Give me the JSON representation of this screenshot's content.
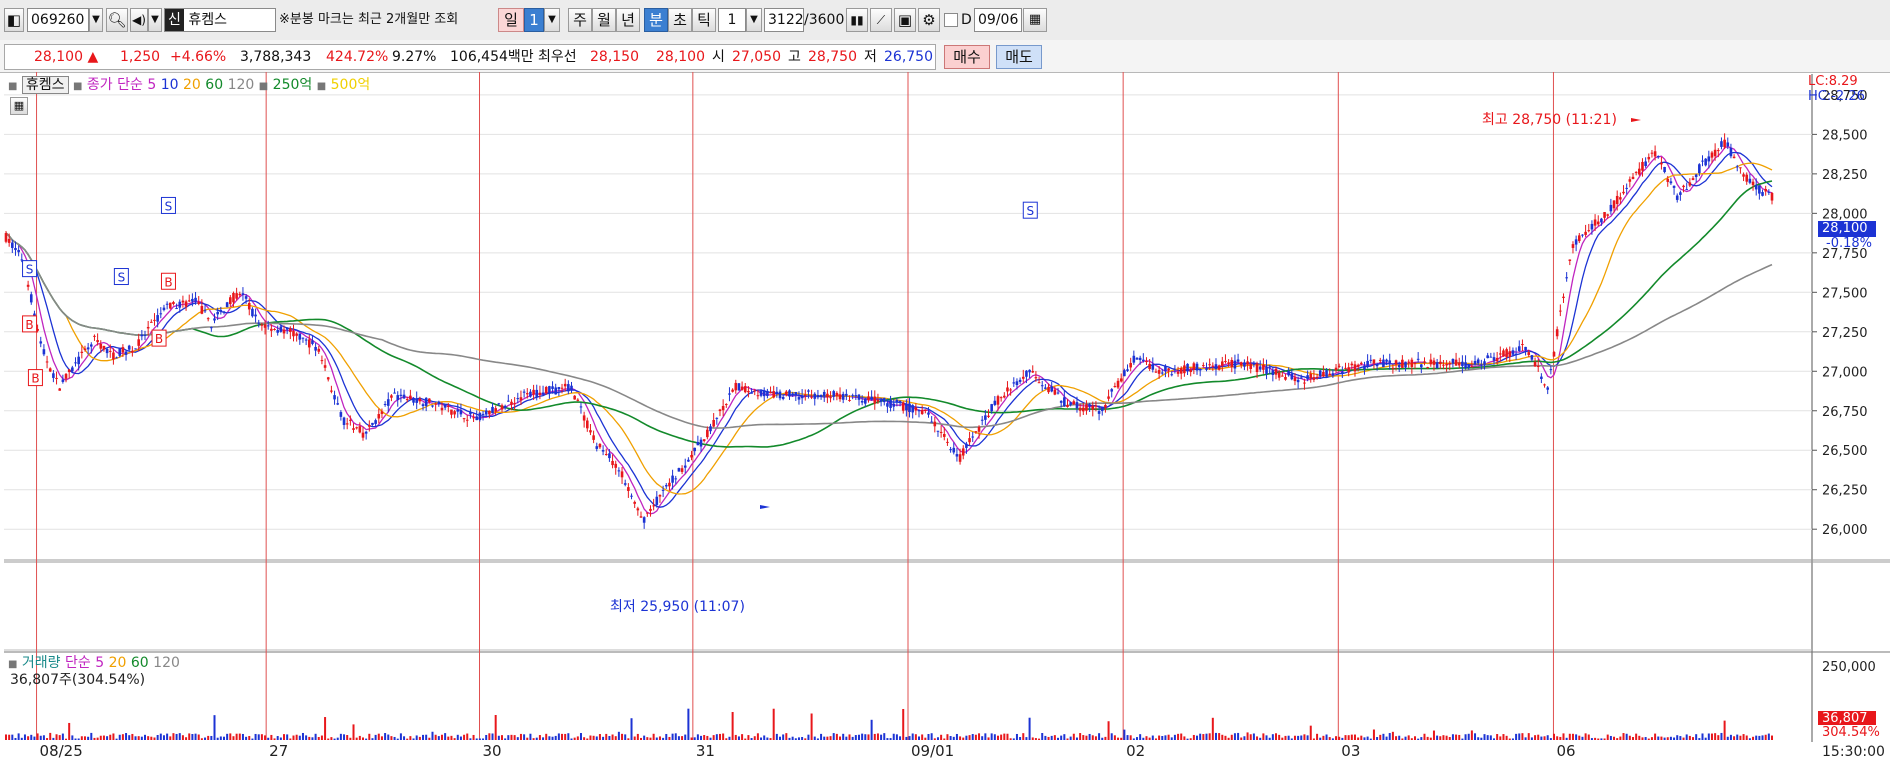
{
  "toolbar": {
    "code": "069260",
    "company_badge": "신",
    "company": "휴켐스",
    "notice": "※분봉 마크는 최근 2개월만 조회",
    "period_day": "일",
    "period_day_value": "1",
    "period_week": "주",
    "period_month": "월",
    "period_year": "년",
    "period_minute": "분",
    "period_second": "초",
    "period_tick": "틱",
    "interval_value": "1",
    "count": "3122",
    "count_total": "/3600",
    "d_label": "D",
    "date": "09/06"
  },
  "quote": {
    "price": "28,100",
    "change": "1,250",
    "change_pct": "+4.66%",
    "volume": "3,788,343",
    "volume_ratio": "424.72%",
    "turnover_rate": "9.27%",
    "amount": "106,454백만",
    "best_label": "최우선",
    "best_ask": "28,150",
    "best_bid": "28,100",
    "open_label": "시",
    "open": "27,050",
    "high_label": "고",
    "high": "28,750",
    "low_label": "저",
    "low": "26,750",
    "buy_button": "매수",
    "sell_button": "매도"
  },
  "price_legend": {
    "name": "휴켐스",
    "close_label": "종가",
    "sma_label": "단순",
    "p5": "5",
    "p10": "10",
    "p20": "20",
    "p60": "60",
    "p120": "120",
    "amt250": "250억",
    "amt500": "500억"
  },
  "volume_legend": {
    "name": "거래량",
    "sma_label": "단순",
    "p5": "5",
    "p20": "20",
    "p60": "60",
    "p120": "120",
    "current": "36,807주(304.54%)"
  },
  "right_info": {
    "lc": "LC:8.29",
    "hc": "HC:-2.26",
    "current_price": "28,100",
    "current_pct": "-0.18%",
    "vol_max": "250,000",
    "vol_current": "36,807",
    "vol_pct": "304.54%",
    "time": "15:30:00"
  },
  "annotations": {
    "high": "최고 28,750 (11:21)",
    "low": "최저 25,950 (11:07)"
  },
  "chart_data": {
    "type": "candlestick",
    "price_ticks": [
      {
        "label": "28,750",
        "v": 28750
      },
      {
        "label": "28,500",
        "v": 28500
      },
      {
        "label": "28,250",
        "v": 28250
      },
      {
        "label": "28,000",
        "v": 28000
      },
      {
        "label": "27,750",
        "v": 27750
      },
      {
        "label": "27,500",
        "v": 27500
      },
      {
        "label": "27,250",
        "v": 27250
      },
      {
        "label": "27,000",
        "v": 27000
      },
      {
        "label": "26,750",
        "v": 26750
      },
      {
        "label": "26,500",
        "v": 26500
      },
      {
        "label": "26,250",
        "v": 26250
      },
      {
        "label": "26,000",
        "v": 26000
      }
    ],
    "y_range": [
      25805,
      28895
    ],
    "x_labels": [
      "08/25",
      "27",
      "30",
      "31",
      "09/01",
      "02",
      "03",
      "06"
    ],
    "session_starts": [
      0.018,
      0.145,
      0.263,
      0.381,
      0.5,
      0.619,
      0.738,
      0.857
    ],
    "price_path": [
      [
        0,
        27850
      ],
      [
        0.015,
        27700
      ],
      [
        0.03,
        27150
      ],
      [
        0.045,
        26900
      ],
      [
        0.06,
        27050
      ],
      [
        0.075,
        27200
      ],
      [
        0.09,
        27100
      ],
      [
        0.11,
        27150
      ],
      [
        0.135,
        27400
      ],
      [
        0.16,
        27450
      ],
      [
        0.175,
        27300
      ],
      [
        0.19,
        27450
      ],
      [
        0.2,
        27500
      ],
      [
        0.215,
        27300
      ],
      [
        0.24,
        27250
      ],
      [
        0.265,
        27150
      ],
      [
        0.285,
        26700
      ],
      [
        0.305,
        26600
      ],
      [
        0.33,
        26850
      ],
      [
        0.36,
        26800
      ],
      [
        0.4,
        26700
      ],
      [
        0.44,
        26850
      ],
      [
        0.48,
        26900
      ],
      [
        0.5,
        26550
      ],
      [
        0.52,
        26400
      ],
      [
        0.54,
        26050
      ],
      [
        0.56,
        26250
      ],
      [
        0.6,
        26650
      ],
      [
        0.62,
        26900
      ],
      [
        0.65,
        26850
      ],
      [
        0.7,
        26850
      ],
      [
        0.75,
        26800
      ],
      [
        0.78,
        26750
      ],
      [
        0.81,
        26450
      ],
      [
        0.84,
        26800
      ],
      [
        0.87,
        27000
      ],
      [
        0.9,
        26800
      ],
      [
        0.93,
        26750
      ],
      [
        0.96,
        27100
      ],
      [
        0.98,
        27000
      ],
      [
        1.05,
        27050
      ],
      [
        1.1,
        26950
      ],
      [
        1.16,
        27050
      ],
      [
        1.21,
        27050
      ],
      [
        1.25,
        27050
      ],
      [
        1.29,
        27150
      ],
      [
        1.31,
        26900
      ],
      [
        1.33,
        27800
      ],
      [
        1.36,
        28000
      ],
      [
        1.38,
        28200
      ],
      [
        1.4,
        28400
      ],
      [
        1.42,
        28100
      ],
      [
        1.44,
        28300
      ],
      [
        1.46,
        28450
      ],
      [
        1.48,
        28200
      ],
      [
        1.5,
        28100
      ]
    ],
    "volume_max": 250000,
    "signals": [
      {
        "type": "S",
        "x": 0.02,
        "v": 27650
      },
      {
        "type": "B",
        "x": 0.02,
        "v": 27300
      },
      {
        "type": "B",
        "x": 0.025,
        "v": 26960
      },
      {
        "type": "S",
        "x": 0.098,
        "v": 27600
      },
      {
        "type": "S",
        "x": 0.138,
        "v": 28050
      },
      {
        "type": "B",
        "x": 0.138,
        "v": 27570
      },
      {
        "type": "B",
        "x": 0.13,
        "v": 27210
      },
      {
        "type": "S",
        "x": 0.87,
        "v": 28020
      }
    ]
  }
}
